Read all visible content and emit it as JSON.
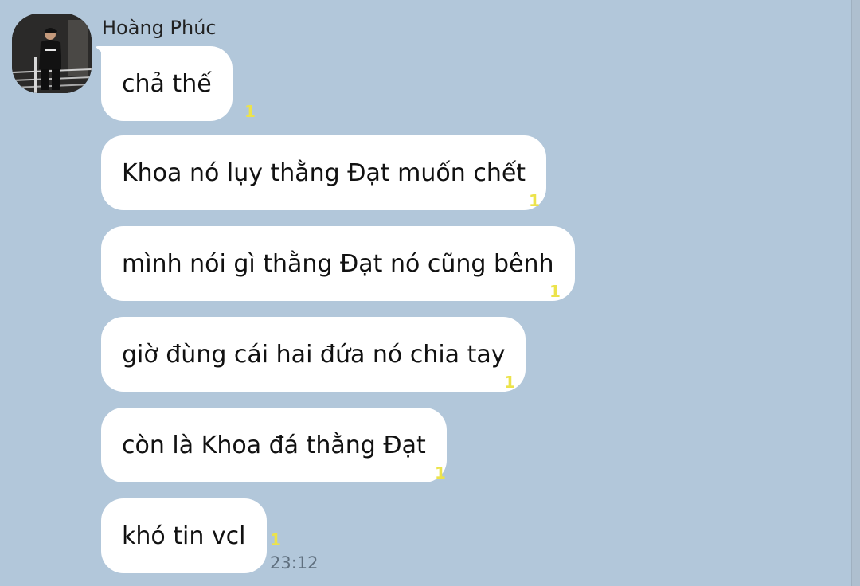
{
  "chat": {
    "sender_name": "Hoàng Phúc",
    "avatar_icon": "user-avatar-photo",
    "background_color": "#b2c7da",
    "bubble_color": "#ffffff",
    "unread_color": "#ece34b",
    "messages": [
      {
        "text": "chả thế",
        "unread": "1"
      },
      {
        "text": "Khoa nó lụy thằng Đạt muốn chết",
        "unread": "1"
      },
      {
        "text": "mình nói gì thằng Đạt nó cũng bênh",
        "unread": "1"
      },
      {
        "text": "giờ đùng cái hai đứa nó chia tay",
        "unread": "1"
      },
      {
        "text": "còn là Khoa đá thằng Đạt",
        "unread": "1"
      },
      {
        "text": "khó tin vcl",
        "unread": "1",
        "time": "23:12"
      }
    ]
  }
}
